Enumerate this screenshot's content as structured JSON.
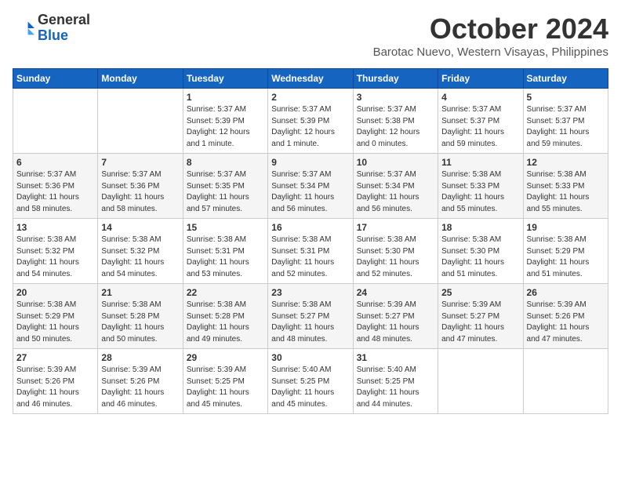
{
  "header": {
    "logo_general": "General",
    "logo_blue": "Blue",
    "month": "October 2024",
    "location": "Barotac Nuevo, Western Visayas, Philippines"
  },
  "weekdays": [
    "Sunday",
    "Monday",
    "Tuesday",
    "Wednesday",
    "Thursday",
    "Friday",
    "Saturday"
  ],
  "weeks": [
    [
      {
        "day": "",
        "info": ""
      },
      {
        "day": "",
        "info": ""
      },
      {
        "day": "1",
        "info": "Sunrise: 5:37 AM\nSunset: 5:39 PM\nDaylight: 12 hours\nand 1 minute."
      },
      {
        "day": "2",
        "info": "Sunrise: 5:37 AM\nSunset: 5:39 PM\nDaylight: 12 hours\nand 1 minute."
      },
      {
        "day": "3",
        "info": "Sunrise: 5:37 AM\nSunset: 5:38 PM\nDaylight: 12 hours\nand 0 minutes."
      },
      {
        "day": "4",
        "info": "Sunrise: 5:37 AM\nSunset: 5:37 PM\nDaylight: 11 hours\nand 59 minutes."
      },
      {
        "day": "5",
        "info": "Sunrise: 5:37 AM\nSunset: 5:37 PM\nDaylight: 11 hours\nand 59 minutes."
      }
    ],
    [
      {
        "day": "6",
        "info": "Sunrise: 5:37 AM\nSunset: 5:36 PM\nDaylight: 11 hours\nand 58 minutes."
      },
      {
        "day": "7",
        "info": "Sunrise: 5:37 AM\nSunset: 5:36 PM\nDaylight: 11 hours\nand 58 minutes."
      },
      {
        "day": "8",
        "info": "Sunrise: 5:37 AM\nSunset: 5:35 PM\nDaylight: 11 hours\nand 57 minutes."
      },
      {
        "day": "9",
        "info": "Sunrise: 5:37 AM\nSunset: 5:34 PM\nDaylight: 11 hours\nand 56 minutes."
      },
      {
        "day": "10",
        "info": "Sunrise: 5:37 AM\nSunset: 5:34 PM\nDaylight: 11 hours\nand 56 minutes."
      },
      {
        "day": "11",
        "info": "Sunrise: 5:38 AM\nSunset: 5:33 PM\nDaylight: 11 hours\nand 55 minutes."
      },
      {
        "day": "12",
        "info": "Sunrise: 5:38 AM\nSunset: 5:33 PM\nDaylight: 11 hours\nand 55 minutes."
      }
    ],
    [
      {
        "day": "13",
        "info": "Sunrise: 5:38 AM\nSunset: 5:32 PM\nDaylight: 11 hours\nand 54 minutes."
      },
      {
        "day": "14",
        "info": "Sunrise: 5:38 AM\nSunset: 5:32 PM\nDaylight: 11 hours\nand 54 minutes."
      },
      {
        "day": "15",
        "info": "Sunrise: 5:38 AM\nSunset: 5:31 PM\nDaylight: 11 hours\nand 53 minutes."
      },
      {
        "day": "16",
        "info": "Sunrise: 5:38 AM\nSunset: 5:31 PM\nDaylight: 11 hours\nand 52 minutes."
      },
      {
        "day": "17",
        "info": "Sunrise: 5:38 AM\nSunset: 5:30 PM\nDaylight: 11 hours\nand 52 minutes."
      },
      {
        "day": "18",
        "info": "Sunrise: 5:38 AM\nSunset: 5:30 PM\nDaylight: 11 hours\nand 51 minutes."
      },
      {
        "day": "19",
        "info": "Sunrise: 5:38 AM\nSunset: 5:29 PM\nDaylight: 11 hours\nand 51 minutes."
      }
    ],
    [
      {
        "day": "20",
        "info": "Sunrise: 5:38 AM\nSunset: 5:29 PM\nDaylight: 11 hours\nand 50 minutes."
      },
      {
        "day": "21",
        "info": "Sunrise: 5:38 AM\nSunset: 5:28 PM\nDaylight: 11 hours\nand 50 minutes."
      },
      {
        "day": "22",
        "info": "Sunrise: 5:38 AM\nSunset: 5:28 PM\nDaylight: 11 hours\nand 49 minutes."
      },
      {
        "day": "23",
        "info": "Sunrise: 5:38 AM\nSunset: 5:27 PM\nDaylight: 11 hours\nand 48 minutes."
      },
      {
        "day": "24",
        "info": "Sunrise: 5:39 AM\nSunset: 5:27 PM\nDaylight: 11 hours\nand 48 minutes."
      },
      {
        "day": "25",
        "info": "Sunrise: 5:39 AM\nSunset: 5:27 PM\nDaylight: 11 hours\nand 47 minutes."
      },
      {
        "day": "26",
        "info": "Sunrise: 5:39 AM\nSunset: 5:26 PM\nDaylight: 11 hours\nand 47 minutes."
      }
    ],
    [
      {
        "day": "27",
        "info": "Sunrise: 5:39 AM\nSunset: 5:26 PM\nDaylight: 11 hours\nand 46 minutes."
      },
      {
        "day": "28",
        "info": "Sunrise: 5:39 AM\nSunset: 5:26 PM\nDaylight: 11 hours\nand 46 minutes."
      },
      {
        "day": "29",
        "info": "Sunrise: 5:39 AM\nSunset: 5:25 PM\nDaylight: 11 hours\nand 45 minutes."
      },
      {
        "day": "30",
        "info": "Sunrise: 5:40 AM\nSunset: 5:25 PM\nDaylight: 11 hours\nand 45 minutes."
      },
      {
        "day": "31",
        "info": "Sunrise: 5:40 AM\nSunset: 5:25 PM\nDaylight: 11 hours\nand 44 minutes."
      },
      {
        "day": "",
        "info": ""
      },
      {
        "day": "",
        "info": ""
      }
    ]
  ]
}
